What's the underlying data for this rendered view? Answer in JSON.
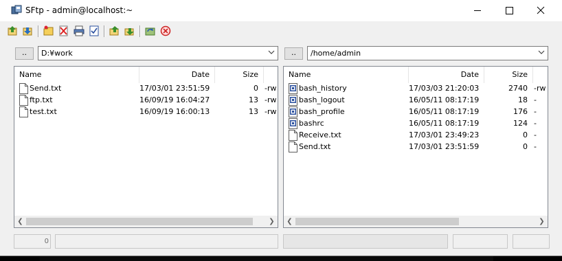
{
  "window": {
    "title": "SFtp - admin@localhost:~",
    "controls": {
      "minimize": "—",
      "maximize": "☐",
      "close": "✕"
    }
  },
  "toolbar": {
    "icons": [
      "upload-icon",
      "download-icon",
      "new-folder-icon",
      "delete-icon",
      "print-icon",
      "properties-icon",
      "upload-all-icon",
      "download-all-icon",
      "sync-icon",
      "disconnect-icon"
    ]
  },
  "local": {
    "up_label": "..",
    "path": "D:¥work",
    "columns": {
      "name": "Name",
      "date": "Date",
      "size": "Size",
      "extra": ""
    },
    "files": [
      {
        "name": "Send.txt",
        "date": "17/03/01 23:51:59",
        "size": "0",
        "extra": "-rw"
      },
      {
        "name": "ftp.txt",
        "date": "16/09/19 16:04:27",
        "size": "13",
        "extra": "-rw"
      },
      {
        "name": "test.txt",
        "date": "16/09/19 16:00:13",
        "size": "13",
        "extra": "-rw"
      }
    ]
  },
  "remote": {
    "up_label": "..",
    "path": "/home/admin",
    "columns": {
      "name": "Name",
      "date": "Date",
      "size": "Size",
      "extra": ""
    },
    "files": [
      {
        "name": "bash_history",
        "date": "17/03/03 21:20:03",
        "size": "2740",
        "extra": "-rw",
        "type": "system"
      },
      {
        "name": "bash_logout",
        "date": "16/05/11 08:17:19",
        "size": "18",
        "extra": "-",
        "type": "system"
      },
      {
        "name": "bash_profile",
        "date": "16/05/11 08:17:19",
        "size": "176",
        "extra": "-",
        "type": "system"
      },
      {
        "name": "bashrc",
        "date": "16/05/11 08:17:19",
        "size": "124",
        "extra": "-",
        "type": "system"
      },
      {
        "name": "Receive.txt",
        "date": "17/03/01 23:49:23",
        "size": "0",
        "extra": "-",
        "type": "text"
      },
      {
        "name": "Send.txt",
        "date": "17/03/01 23:51:59",
        "size": "0",
        "extra": "-",
        "type": "text"
      }
    ]
  },
  "statusbar": {
    "left_count": "0"
  },
  "colors": {
    "window_bg": "#f0f0f0",
    "close_red": "#e81123",
    "accent_blue": "#2a5db0"
  }
}
